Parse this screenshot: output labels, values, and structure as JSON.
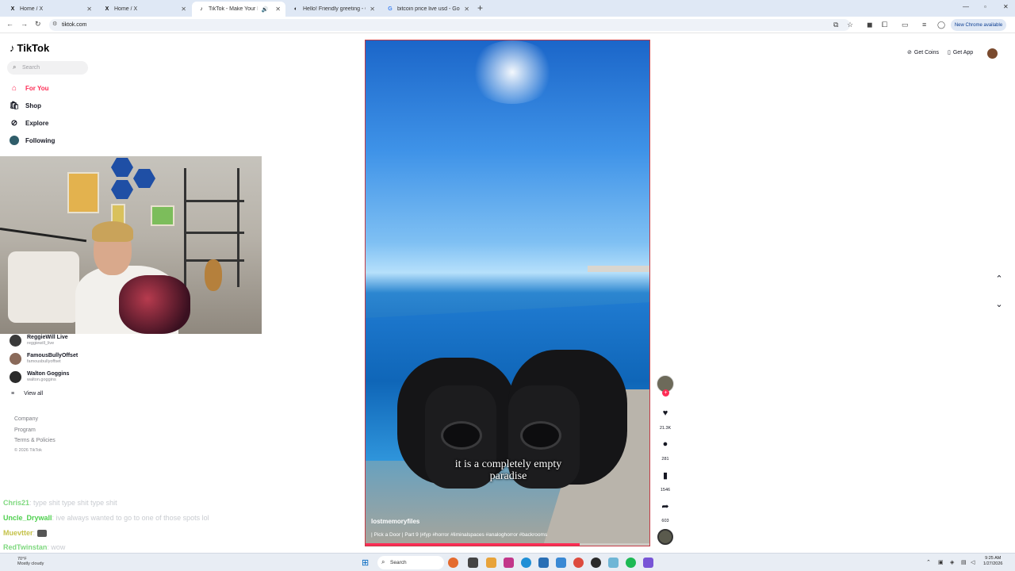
{
  "browser": {
    "tabs": [
      {
        "icon": "X",
        "title": "Home / X"
      },
      {
        "icon": "X",
        "title": "Home / X"
      },
      {
        "icon": "♪",
        "title": "TikTok - Make Your Day"
      },
      {
        "icon": "◐",
        "title": "Hello! Friendly greeting - Grok"
      },
      {
        "icon": "G",
        "title": "bitcoin price live usd - Google"
      }
    ],
    "url": "tiktok.com",
    "update_label": "New Chrome available"
  },
  "tiktok": {
    "logo": "TikTok",
    "search_placeholder": "Search",
    "nav": [
      {
        "label": "For You",
        "icon": "home-icon"
      },
      {
        "label": "Shop",
        "icon": "shopping-bag-icon"
      },
      {
        "label": "Explore",
        "icon": "compass-icon"
      },
      {
        "label": "Following",
        "icon": "avatar"
      }
    ],
    "accounts": [
      {
        "name": "ReggieWill Live",
        "handle": "reggiewill_live"
      },
      {
        "name": "FamousBullyOffset",
        "handle": "famousbullyoffset"
      },
      {
        "name": "Walton Goggins",
        "handle": "walton.goggins"
      }
    ],
    "view_all": "View all",
    "footer": [
      "Company",
      "Program",
      "Terms & Policies"
    ],
    "copyright": "© 2026 TikTok",
    "top_right": {
      "coins": "Get Coins",
      "app": "Get App"
    }
  },
  "video": {
    "caption_line1": "it is a completely empty",
    "caption_line2": "paradise",
    "author": "lostmemoryfiles",
    "description": "| Pick a Door | Part 9 |#fyp #horror #liminalspaces #analoghorror #backrooms",
    "progress": 0.75,
    "likes": "21.3K",
    "comments": "281",
    "saves": "1546",
    "shares": "603"
  },
  "chat": [
    {
      "user": "Chris21",
      "color": "#7fd87f",
      "message": ": type shit type shit type shit"
    },
    {
      "user": "Uncle_Drywall",
      "color": "#4fd04f",
      "message": ": ive always wanted to go to one of those spots lol"
    },
    {
      "user": "Muevtter",
      "color": "#c5c24a",
      "message": ":"
    },
    {
      "user": "RedTwinstan",
      "color": "#7fd87f",
      "message": ": wow"
    }
  ],
  "taskbar": {
    "weather_temp": "70°F",
    "weather_desc": "Mostly cloudy",
    "search": "Search",
    "time": "9:25 AM",
    "date": "1/27/2026"
  }
}
